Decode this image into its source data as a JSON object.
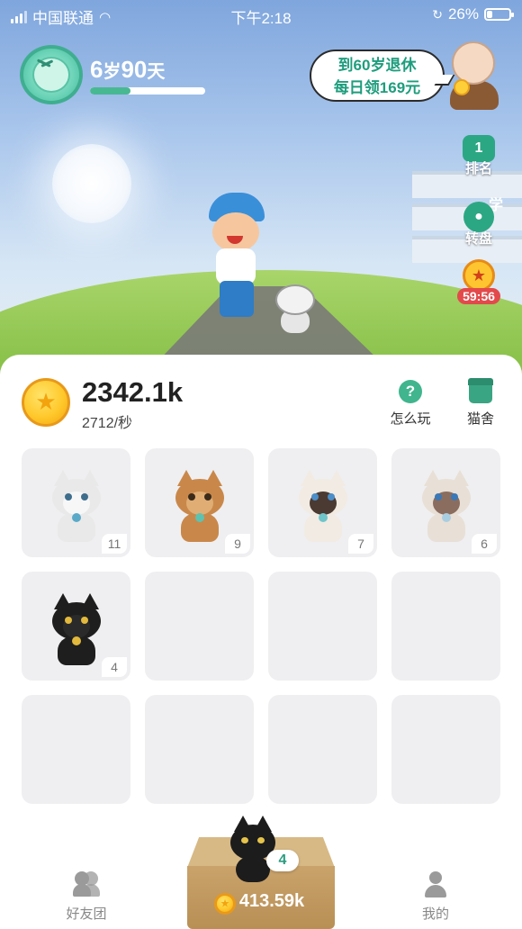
{
  "status_bar": {
    "carrier": "中国联通",
    "time": "下午2:18",
    "battery_percent": "26%",
    "battery_level": 0.26
  },
  "player": {
    "age_years": "6",
    "age_unit_years": "岁",
    "age_days": "90",
    "age_unit_days": "天",
    "age_progress": 0.35
  },
  "retire_bubble": {
    "line1": "到60岁退休",
    "line2": "每日领169元"
  },
  "side_buttons": {
    "rank_number": "1",
    "rank_label": "排名",
    "wheel_label": "转盘",
    "building_sign": "学",
    "timer": "59:56"
  },
  "wallet": {
    "total_coins": "2342.1k",
    "rate": "2712/秒"
  },
  "actions": {
    "how_to_play": "怎么玩",
    "cattery": "猫舍",
    "help_glyph": "?"
  },
  "cats": [
    {
      "level": "11",
      "breed": "silver-tabby",
      "color": "#e9e9e9",
      "mask": "#f7f7f7",
      "eye": "#3e6d8c",
      "bell": "#5aa9c9"
    },
    {
      "level": "9",
      "breed": "abyssinian",
      "color": "#c9884a",
      "mask": "#e0ad74",
      "eye": "#3a2a1a",
      "bell": "#5ec2b0"
    },
    {
      "level": "7",
      "breed": "siamese",
      "color": "#f1ebe3",
      "mask": "#4a3a32",
      "eye": "#4b8ec8",
      "bell": "#6fc5c9"
    },
    {
      "level": "6",
      "breed": "ragdoll",
      "color": "#e8dfd6",
      "mask": "#8a6d5e",
      "eye": "#3a78b8",
      "bell": "#a9cde0"
    },
    {
      "level": "4",
      "breed": "black",
      "color": "#1e1e1e",
      "mask": "#2a2a2a",
      "eye": "#e2b93c",
      "bell": "#e2b93c"
    }
  ],
  "spawn_box": {
    "amount": "413.59k",
    "cat_count": "4"
  },
  "bottom_tabs": {
    "friends": "好友团",
    "me": "我的"
  },
  "colors": {
    "accent_green": "#2ca784",
    "coin_gold": "#ffc92c",
    "cell_bg": "#efeff1"
  }
}
